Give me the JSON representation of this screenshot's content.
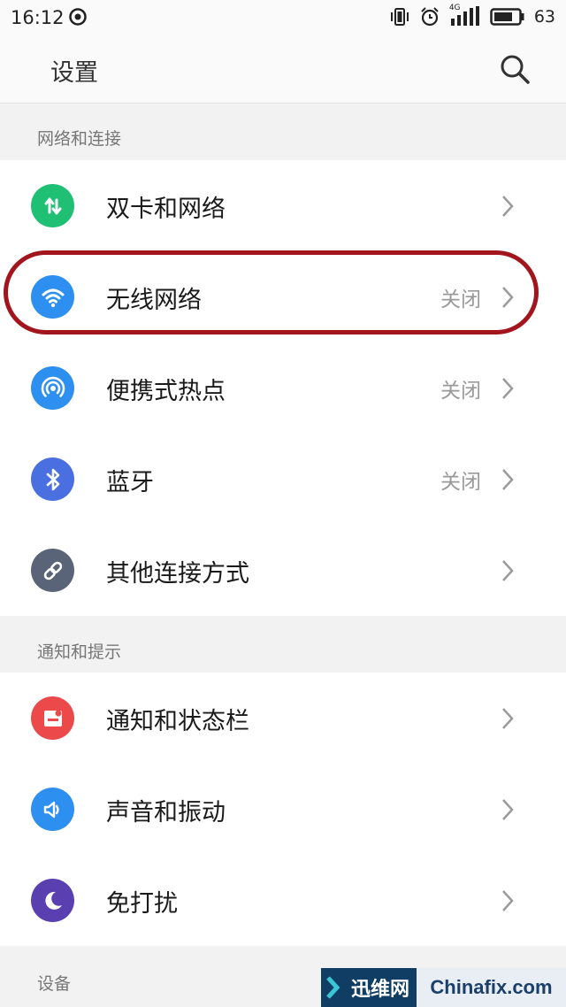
{
  "status_bar": {
    "time": "16:12",
    "network_type": "4G",
    "battery": "63"
  },
  "app_bar": {
    "title": "设置"
  },
  "sections": [
    {
      "header": "网络和连接",
      "items": [
        {
          "label": "双卡和网络",
          "value": "",
          "icon": "dual-sim-icon",
          "color": "#1fbf74"
        },
        {
          "label": "无线网络",
          "value": "关闭",
          "icon": "wifi-icon",
          "color": "#2d8ff0"
        },
        {
          "label": "便携式热点",
          "value": "关闭",
          "icon": "hotspot-icon",
          "color": "#2d8ff0"
        },
        {
          "label": "蓝牙",
          "value": "关闭",
          "icon": "bluetooth-icon",
          "color": "#4a6fe0"
        },
        {
          "label": "其他连接方式",
          "value": "",
          "icon": "link-icon",
          "color": "#5a6478"
        }
      ]
    },
    {
      "header": "通知和提示",
      "items": [
        {
          "label": "通知和状态栏",
          "value": "",
          "icon": "notification-icon",
          "color": "#ec4a4a"
        },
        {
          "label": "声音和振动",
          "value": "",
          "icon": "sound-icon",
          "color": "#2d8ff0"
        },
        {
          "label": "免打扰",
          "value": "",
          "icon": "moon-icon",
          "color": "#5a3fb0"
        }
      ]
    },
    {
      "header": "设备",
      "items": []
    }
  ],
  "watermark": {
    "left_text": "迅维网",
    "right_text": "Chinafix.com"
  }
}
